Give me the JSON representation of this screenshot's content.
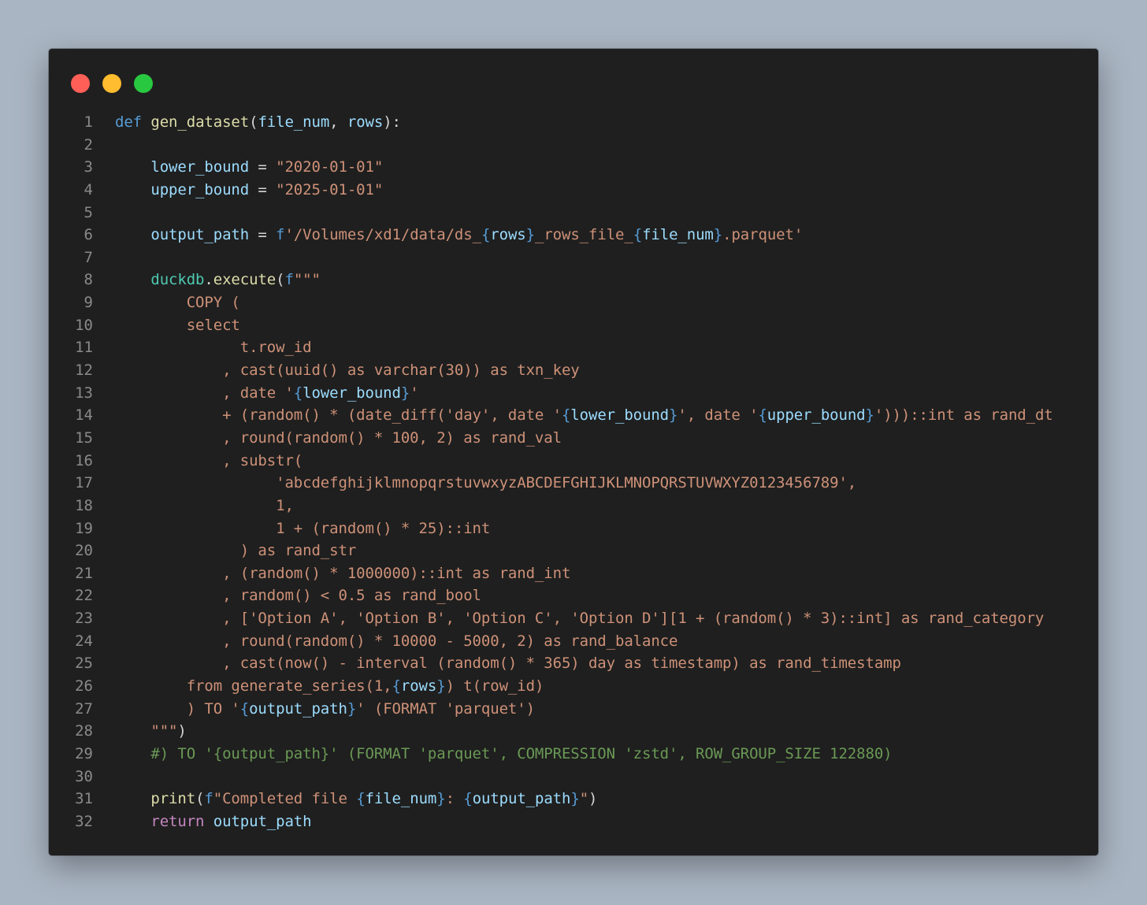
{
  "window": {
    "title_buttons": [
      "close",
      "minimize",
      "zoom"
    ],
    "colors": {
      "background": "#1f1f1f",
      "page_background": "#aab5c3",
      "close": "#ff5f57",
      "minimize": "#febc2e",
      "zoom": "#28c840"
    }
  },
  "code": {
    "language": "python",
    "lines": [
      {
        "n": "1",
        "tokens": [
          {
            "t": "def",
            "c": "kw"
          },
          {
            "t": " ",
            "c": "plain"
          },
          {
            "t": "gen_dataset",
            "c": "fn"
          },
          {
            "t": "(",
            "c": "plain"
          },
          {
            "t": "file_num",
            "c": "var"
          },
          {
            "t": ", ",
            "c": "plain"
          },
          {
            "t": "rows",
            "c": "var"
          },
          {
            "t": "):",
            "c": "plain"
          }
        ]
      },
      {
        "n": "2",
        "tokens": []
      },
      {
        "n": "3",
        "tokens": [
          {
            "t": "    ",
            "c": "plain"
          },
          {
            "t": "lower_bound",
            "c": "var"
          },
          {
            "t": " = ",
            "c": "plain"
          },
          {
            "t": "\"2020-01-01\"",
            "c": "str"
          }
        ]
      },
      {
        "n": "4",
        "tokens": [
          {
            "t": "    ",
            "c": "plain"
          },
          {
            "t": "upper_bound",
            "c": "var"
          },
          {
            "t": " = ",
            "c": "plain"
          },
          {
            "t": "\"2025-01-01\"",
            "c": "str"
          }
        ]
      },
      {
        "n": "5",
        "tokens": []
      },
      {
        "n": "6",
        "tokens": [
          {
            "t": "    ",
            "c": "plain"
          },
          {
            "t": "output_path",
            "c": "var"
          },
          {
            "t": " = ",
            "c": "plain"
          },
          {
            "t": "f",
            "c": "kw"
          },
          {
            "t": "'/Volumes/xd1/data/ds_",
            "c": "str"
          },
          {
            "t": "{",
            "c": "kw"
          },
          {
            "t": "rows",
            "c": "var"
          },
          {
            "t": "}",
            "c": "kw"
          },
          {
            "t": "_rows_file_",
            "c": "str"
          },
          {
            "t": "{",
            "c": "kw"
          },
          {
            "t": "file_num",
            "c": "var"
          },
          {
            "t": "}",
            "c": "kw"
          },
          {
            "t": ".parquet'",
            "c": "str"
          }
        ]
      },
      {
        "n": "7",
        "tokens": []
      },
      {
        "n": "8",
        "tokens": [
          {
            "t": "    ",
            "c": "plain"
          },
          {
            "t": "duckdb",
            "c": "cls"
          },
          {
            "t": ".",
            "c": "plain"
          },
          {
            "t": "execute",
            "c": "fn"
          },
          {
            "t": "(",
            "c": "plain"
          },
          {
            "t": "f",
            "c": "kw"
          },
          {
            "t": "\"\"\"",
            "c": "str"
          }
        ]
      },
      {
        "n": "9",
        "tokens": [
          {
            "t": "        COPY (",
            "c": "str"
          }
        ]
      },
      {
        "n": "10",
        "tokens": [
          {
            "t": "        select",
            "c": "str"
          }
        ]
      },
      {
        "n": "11",
        "tokens": [
          {
            "t": "              t.row_id",
            "c": "str"
          }
        ]
      },
      {
        "n": "12",
        "tokens": [
          {
            "t": "            , cast(uuid() as varchar(30)) as txn_key",
            "c": "str"
          }
        ]
      },
      {
        "n": "13",
        "tokens": [
          {
            "t": "            , date '",
            "c": "str"
          },
          {
            "t": "{",
            "c": "kw"
          },
          {
            "t": "lower_bound",
            "c": "var"
          },
          {
            "t": "}",
            "c": "kw"
          },
          {
            "t": "'",
            "c": "str"
          }
        ]
      },
      {
        "n": "14",
        "tokens": [
          {
            "t": "            + (random() * (date_diff('day', date '",
            "c": "str"
          },
          {
            "t": "{",
            "c": "kw"
          },
          {
            "t": "lower_bound",
            "c": "var"
          },
          {
            "t": "}",
            "c": "kw"
          },
          {
            "t": "', date '",
            "c": "str"
          },
          {
            "t": "{",
            "c": "kw"
          },
          {
            "t": "upper_bound",
            "c": "var"
          },
          {
            "t": "}",
            "c": "kw"
          },
          {
            "t": "')))::int as rand_dt",
            "c": "str"
          }
        ]
      },
      {
        "n": "15",
        "tokens": [
          {
            "t": "            , round(random() * 100, 2) as rand_val",
            "c": "str"
          }
        ]
      },
      {
        "n": "16",
        "tokens": [
          {
            "t": "            , substr(",
            "c": "str"
          }
        ]
      },
      {
        "n": "17",
        "tokens": [
          {
            "t": "                  'abcdefghijklmnopqrstuvwxyzABCDEFGHIJKLMNOPQRSTUVWXYZ0123456789',",
            "c": "str"
          }
        ]
      },
      {
        "n": "18",
        "tokens": [
          {
            "t": "                  1,",
            "c": "str"
          }
        ]
      },
      {
        "n": "19",
        "tokens": [
          {
            "t": "                  1 + (random() * 25)::int",
            "c": "str"
          }
        ]
      },
      {
        "n": "20",
        "tokens": [
          {
            "t": "              ) as rand_str",
            "c": "str"
          }
        ]
      },
      {
        "n": "21",
        "tokens": [
          {
            "t": "            , (random() * 1000000)::int as rand_int",
            "c": "str"
          }
        ]
      },
      {
        "n": "22",
        "tokens": [
          {
            "t": "            , random() < 0.5 as rand_bool",
            "c": "str"
          }
        ]
      },
      {
        "n": "23",
        "tokens": [
          {
            "t": "            , ['Option A', 'Option B', 'Option C', 'Option D'][1 + (random() * 3)::int] as rand_category",
            "c": "str"
          }
        ]
      },
      {
        "n": "24",
        "tokens": [
          {
            "t": "            , round(random() * 10000 - 5000, 2) as rand_balance",
            "c": "str"
          }
        ]
      },
      {
        "n": "25",
        "tokens": [
          {
            "t": "            , cast(now() - interval (random() * 365) day as timestamp) as rand_timestamp",
            "c": "str"
          }
        ]
      },
      {
        "n": "26",
        "tokens": [
          {
            "t": "        from generate_series(1,",
            "c": "str"
          },
          {
            "t": "{",
            "c": "kw"
          },
          {
            "t": "rows",
            "c": "var"
          },
          {
            "t": "}",
            "c": "kw"
          },
          {
            "t": ") t(row_id)",
            "c": "str"
          }
        ]
      },
      {
        "n": "27",
        "tokens": [
          {
            "t": "        ) TO '",
            "c": "str"
          },
          {
            "t": "{",
            "c": "kw"
          },
          {
            "t": "output_path",
            "c": "var"
          },
          {
            "t": "}",
            "c": "kw"
          },
          {
            "t": "' (FORMAT 'parquet')",
            "c": "str"
          }
        ]
      },
      {
        "n": "28",
        "tokens": [
          {
            "t": "    \"\"\"",
            "c": "str"
          },
          {
            "t": ")",
            "c": "plain"
          }
        ]
      },
      {
        "n": "29",
        "tokens": [
          {
            "t": "    #) TO '{output_path}' (FORMAT 'parquet', COMPRESSION 'zstd', ROW_GROUP_SIZE 122880)",
            "c": "cmt"
          }
        ]
      },
      {
        "n": "30",
        "tokens": []
      },
      {
        "n": "31",
        "tokens": [
          {
            "t": "    ",
            "c": "plain"
          },
          {
            "t": "print",
            "c": "fn"
          },
          {
            "t": "(",
            "c": "plain"
          },
          {
            "t": "f",
            "c": "kw"
          },
          {
            "t": "\"Completed file ",
            "c": "str"
          },
          {
            "t": "{",
            "c": "kw"
          },
          {
            "t": "file_num",
            "c": "var"
          },
          {
            "t": "}",
            "c": "kw"
          },
          {
            "t": ": ",
            "c": "str"
          },
          {
            "t": "{",
            "c": "kw"
          },
          {
            "t": "output_path",
            "c": "var"
          },
          {
            "t": "}",
            "c": "kw"
          },
          {
            "t": "\"",
            "c": "str"
          },
          {
            "t": ")",
            "c": "plain"
          }
        ]
      },
      {
        "n": "32",
        "tokens": [
          {
            "t": "    ",
            "c": "plain"
          },
          {
            "t": "return",
            "c": "ctrl"
          },
          {
            "t": " ",
            "c": "plain"
          },
          {
            "t": "output_path",
            "c": "var"
          }
        ]
      }
    ]
  }
}
